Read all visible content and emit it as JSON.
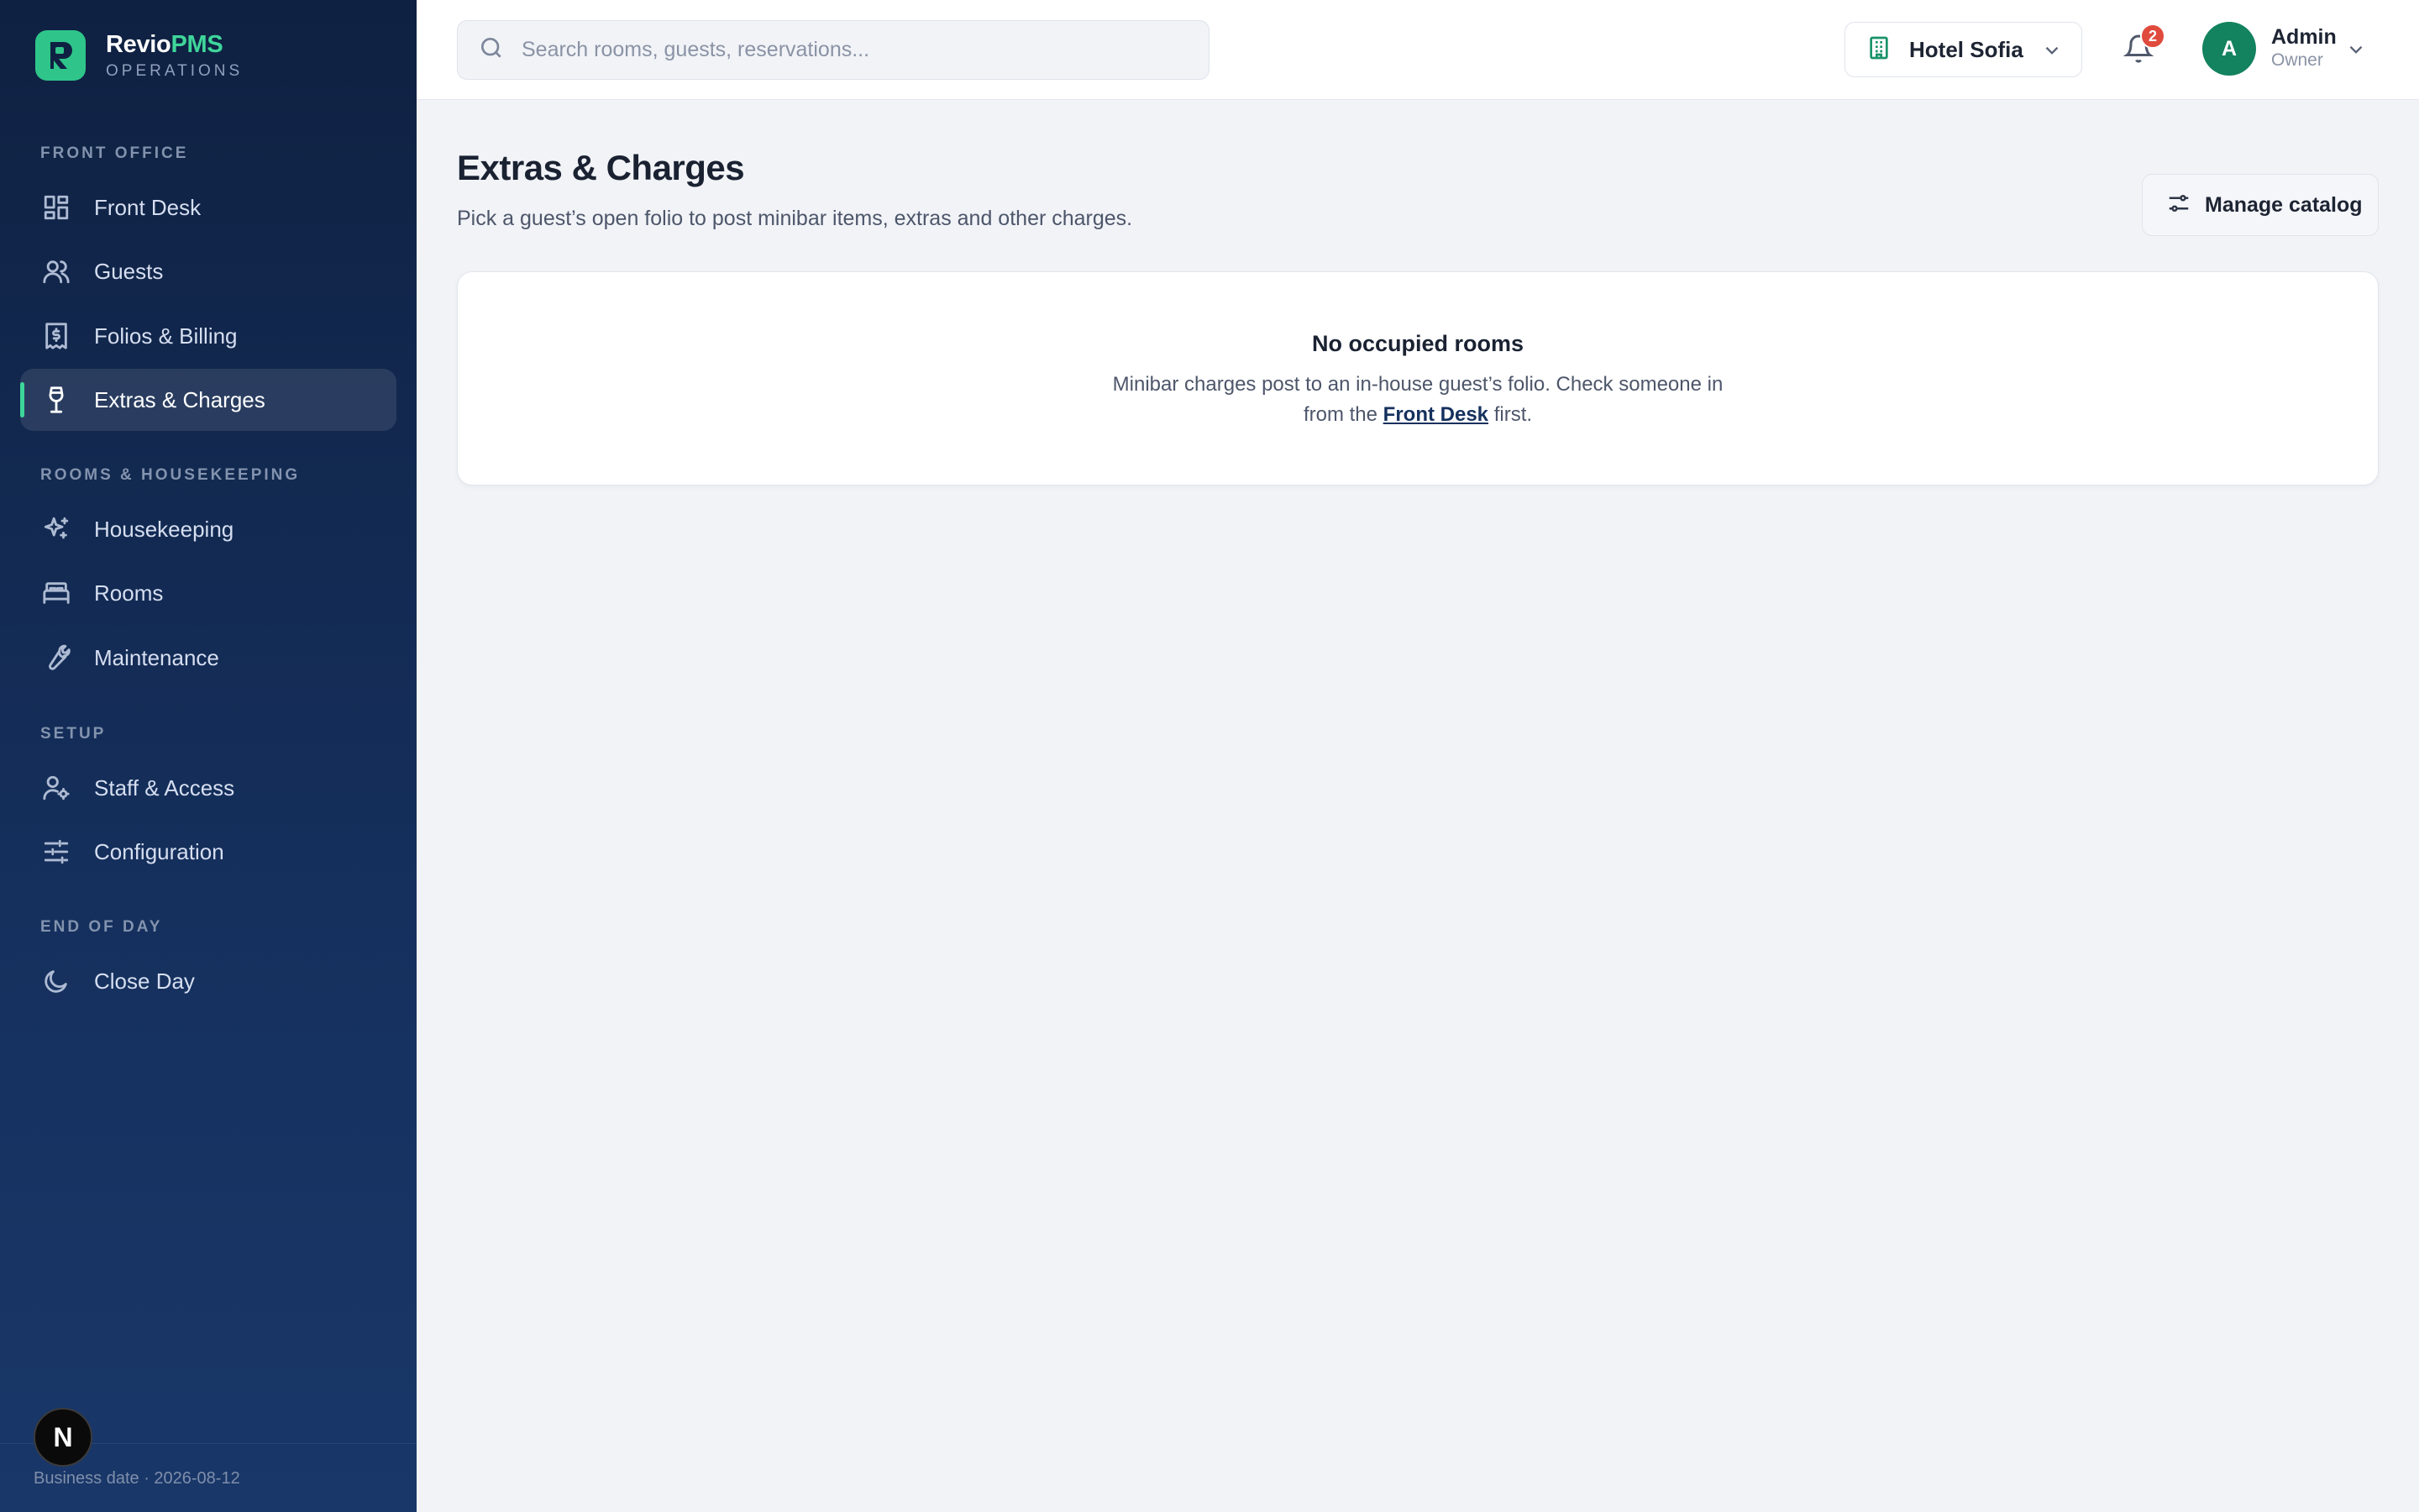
{
  "brand": {
    "name_main": "Revio",
    "name_accent": "PMS",
    "subtitle": "OPERATIONS",
    "accent_color": "#3fd69a"
  },
  "sidebar": {
    "sections": [
      {
        "label": "FRONT OFFICE"
      },
      {
        "label": "ROOMS & HOUSEKEEPING"
      },
      {
        "label": "SETUP"
      },
      {
        "label": "END OF DAY"
      }
    ],
    "items": [
      {
        "label": "Front Desk",
        "icon": "grid-icon"
      },
      {
        "label": "Guests",
        "icon": "users-icon"
      },
      {
        "label": "Folios & Billing",
        "icon": "receipt-icon"
      },
      {
        "label": "Extras & Charges",
        "icon": "wine-glass-icon",
        "active": true
      },
      {
        "label": "Housekeeping",
        "icon": "sparkles-icon"
      },
      {
        "label": "Rooms",
        "icon": "bed-icon"
      },
      {
        "label": "Maintenance",
        "icon": "wrench-icon"
      },
      {
        "label": "Staff & Access",
        "icon": "user-cog-icon"
      },
      {
        "label": "Configuration",
        "icon": "sliders-icon"
      },
      {
        "label": "Close Day",
        "icon": "moon-icon"
      }
    ],
    "footer": {
      "business_date": "Business date · 2026-08-12",
      "badge_letter": "N"
    }
  },
  "topbar": {
    "search_placeholder": "Search rooms, guests, reservations...",
    "hotel": "Hotel Sofia",
    "notification_count": "2",
    "user": {
      "initial": "A",
      "name": "Admin",
      "role": "Owner"
    }
  },
  "main": {
    "title": "Extras & Charges",
    "subtitle": "Pick a guest’s open folio to post minibar items, extras and other charges.",
    "manage_button": "Manage catalog",
    "empty": {
      "title": "No occupied rooms",
      "line1": "Minibar charges post to an in-house guest’s folio. Check someone in",
      "line2_before": "from the",
      "link": "Front Desk",
      "line2_after": "first."
    }
  }
}
